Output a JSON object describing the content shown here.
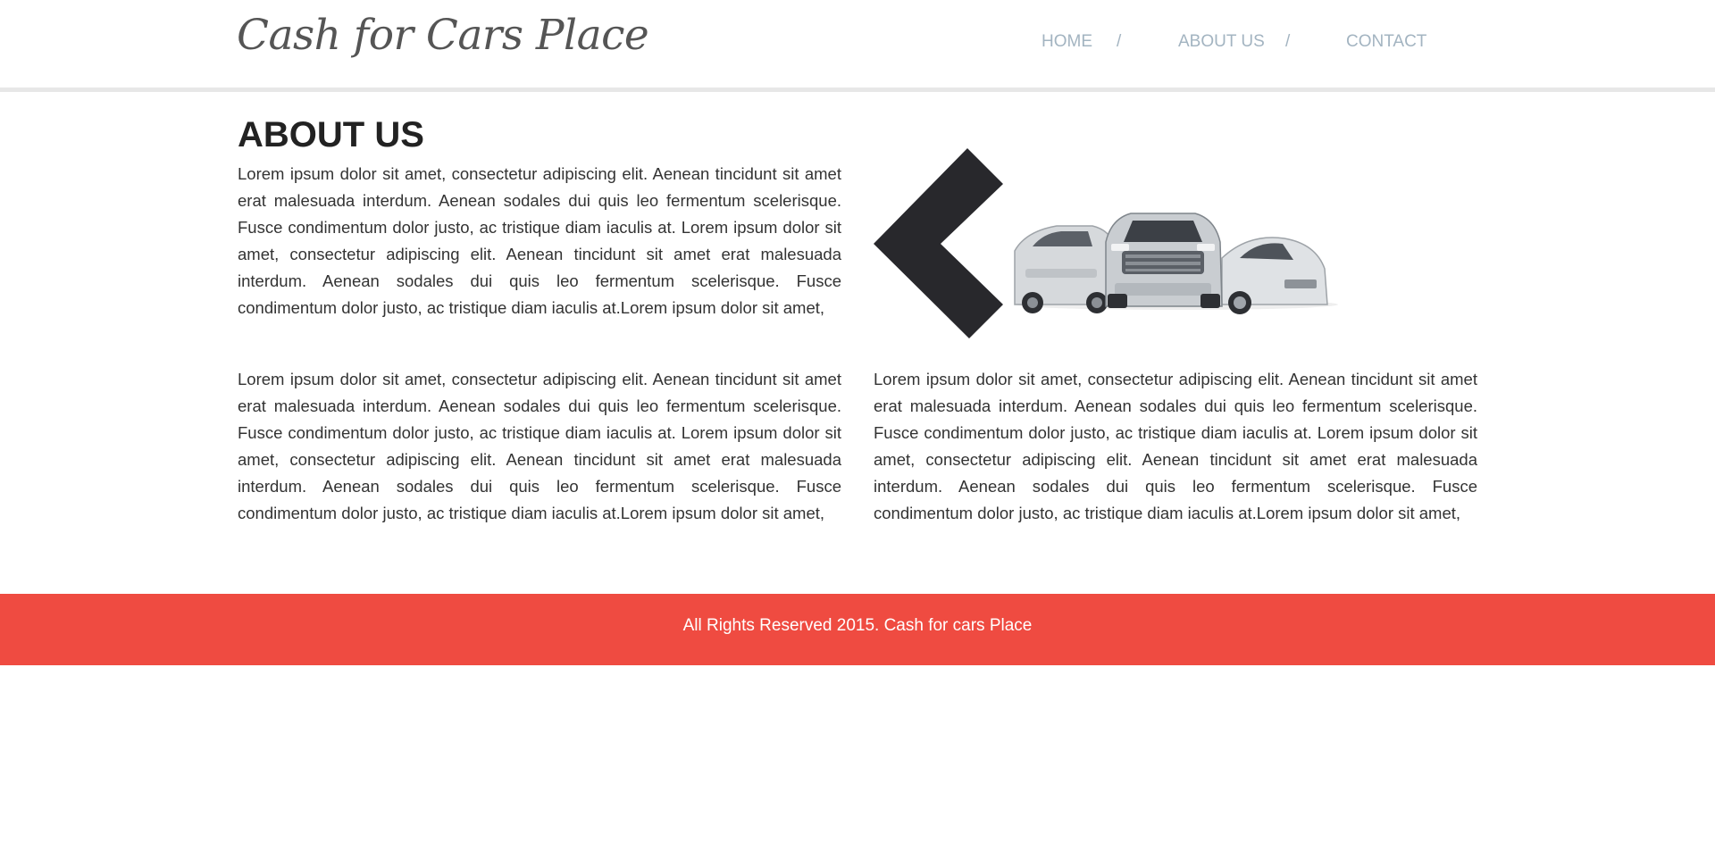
{
  "header": {
    "logo": "Cash for Cars Place",
    "nav": [
      {
        "label": "HOME"
      },
      {
        "label": "ABOUT US"
      },
      {
        "label": "CONTACT"
      }
    ],
    "separator": "/"
  },
  "main": {
    "title": "ABOUT US",
    "paragraphs": [
      "Lorem ipsum dolor sit amet, consectetur adipiscing elit. Aenean tincidunt sit amet erat malesuada interdum. Aenean sodales dui quis leo fermentum scelerisque. Fusce condimentum dolor justo, ac tristique diam iaculis at. Lorem ipsum dolor sit amet, consectetur adipiscing elit. Aenean tincidunt sit amet erat malesuada interdum. Aenean sodales dui quis leo fermentum scelerisque. Fusce condimentum dolor justo, ac tristique diam iaculis at.Lorem ipsum dolor sit amet,",
      "Lorem ipsum dolor sit amet, consectetur adipiscing elit. Aenean tincidunt sit amet erat malesuada interdum. Aenean sodales dui quis leo fermentum scelerisque. Fusce condimentum dolor justo, ac tristique diam iaculis at. Lorem ipsum dolor sit amet, consectetur adipiscing elit. Aenean tincidunt sit amet erat malesuada interdum. Aenean sodales dui quis leo fermentum scelerisque. Fusce condimentum dolor justo, ac tristique diam iaculis at.Lorem ipsum dolor sit amet,",
      "Lorem ipsum dolor sit amet, consectetur adipiscing elit. Aenean tincidunt sit amet erat malesuada interdum. Aenean sodales dui quis leo fermentum scelerisque. Fusce condimentum dolor justo, ac tristique diam iaculis at. Lorem ipsum dolor sit amet, consectetur adipiscing elit. Aenean tincidunt sit amet erat malesuada interdum. Aenean sodales dui quis leo fermentum scelerisque. Fusce condimentum dolor justo, ac tristique diam iaculis at.Lorem ipsum dolor sit amet,"
    ],
    "hero_icon": "chevron-left-icon"
  },
  "footer": {
    "text": "All Rights Reserved 2015. Cash for cars Place"
  },
  "colors": {
    "footer_bg": "#ef4b41",
    "nav_text": "#a3b4c1",
    "chevron": "#28282c"
  }
}
